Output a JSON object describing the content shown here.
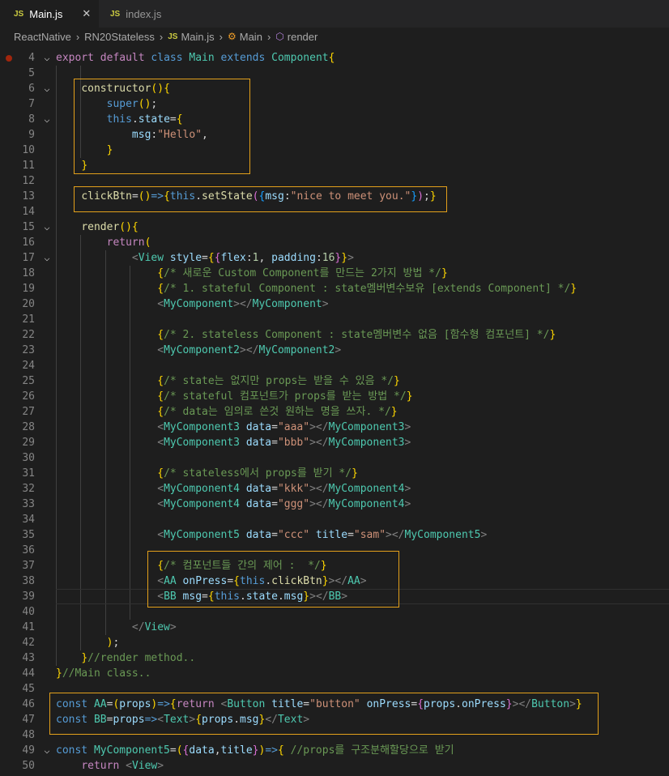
{
  "tabs": [
    {
      "icon": "JS",
      "label": "Main.js",
      "active": true,
      "close": "✕"
    },
    {
      "icon": "JS",
      "label": "index.js",
      "active": false
    }
  ],
  "breadcrumb": {
    "items": [
      "ReactNative",
      "RN20Stateless",
      "Main.js",
      "Main",
      "render"
    ],
    "separator": "›"
  },
  "code": {
    "lines": [
      {
        "n": "4",
        "text": "export default class Main extends Component{"
      },
      {
        "n": "5",
        "text": ""
      },
      {
        "n": "6",
        "text": "    constructor(){"
      },
      {
        "n": "7",
        "text": "        super();"
      },
      {
        "n": "8",
        "text": "        this.state={"
      },
      {
        "n": "9",
        "text": "            msg:\"Hello\","
      },
      {
        "n": "10",
        "text": "        }"
      },
      {
        "n": "11",
        "text": "    }"
      },
      {
        "n": "12",
        "text": ""
      },
      {
        "n": "13",
        "text": "    clickBtn=()=>{this.setState({msg:\"nice to meet you.\"});}"
      },
      {
        "n": "14",
        "text": ""
      },
      {
        "n": "15",
        "text": "    render(){"
      },
      {
        "n": "16",
        "text": "        return("
      },
      {
        "n": "17",
        "text": "            <View style={{flex:1, padding:16}}>"
      },
      {
        "n": "18",
        "text": "                {/* 새로운 Custom Component를 만드는 2가지 방법 */}"
      },
      {
        "n": "19",
        "text": "                {/* 1. stateful Component : state멤버변수보유 [extends Component] */}"
      },
      {
        "n": "20",
        "text": "                <MyComponent></MyComponent>"
      },
      {
        "n": "21",
        "text": ""
      },
      {
        "n": "22",
        "text": "                {/* 2. stateless Component : state멤버변수 없음 [함수형 컴포넌트] */}"
      },
      {
        "n": "23",
        "text": "                <MyComponent2></MyComponent2>"
      },
      {
        "n": "24",
        "text": ""
      },
      {
        "n": "25",
        "text": "                {/* state는 없지만 props는 받을 수 있음 */}"
      },
      {
        "n": "26",
        "text": "                {/* stateful 컴포넌트가 props를 받는 방법 */}"
      },
      {
        "n": "27",
        "text": "                {/* data는 임의로 쓴것 원하는 명을 쓰자. */}"
      },
      {
        "n": "28",
        "text": "                <MyComponent3 data=\"aaa\"></MyComponent3>"
      },
      {
        "n": "29",
        "text": "                <MyComponent3 data=\"bbb\"></MyComponent3>"
      },
      {
        "n": "30",
        "text": ""
      },
      {
        "n": "31",
        "text": "                {/* stateless에서 props를 받기 */}"
      },
      {
        "n": "32",
        "text": "                <MyComponent4 data=\"kkk\"></MyComponent4>"
      },
      {
        "n": "33",
        "text": "                <MyComponent4 data=\"ggg\"></MyComponent4>"
      },
      {
        "n": "34",
        "text": ""
      },
      {
        "n": "35",
        "text": "                <MyComponent5 data=\"ccc\" title=\"sam\"></MyComponent5>"
      },
      {
        "n": "36",
        "text": ""
      },
      {
        "n": "37",
        "text": "                {/* 컴포넌트들 간의 제어 :  */}"
      },
      {
        "n": "38",
        "text": "                <AA onPress={this.clickBtn}></AA>"
      },
      {
        "n": "39",
        "text": "                <BB msg={this.state.msg}></BB>"
      },
      {
        "n": "40",
        "text": ""
      },
      {
        "n": "41",
        "text": "            </View>"
      },
      {
        "n": "42",
        "text": "        );"
      },
      {
        "n": "43",
        "text": "    }//render method.."
      },
      {
        "n": "44",
        "text": "}//Main class.."
      },
      {
        "n": "45",
        "text": ""
      },
      {
        "n": "46",
        "text": "const AA=(props)=>{return <Button title=\"button\" onPress={props.onPress}></Button>}"
      },
      {
        "n": "47",
        "text": "const BB=props=><Text>{props.msg}</Text>"
      },
      {
        "n": "48",
        "text": ""
      },
      {
        "n": "49",
        "text": "const MyComponent5=({data,title})=>{ //props를 구조분해할당으로 받기"
      },
      {
        "n": "50",
        "text": "    return <View>"
      }
    ]
  }
}
